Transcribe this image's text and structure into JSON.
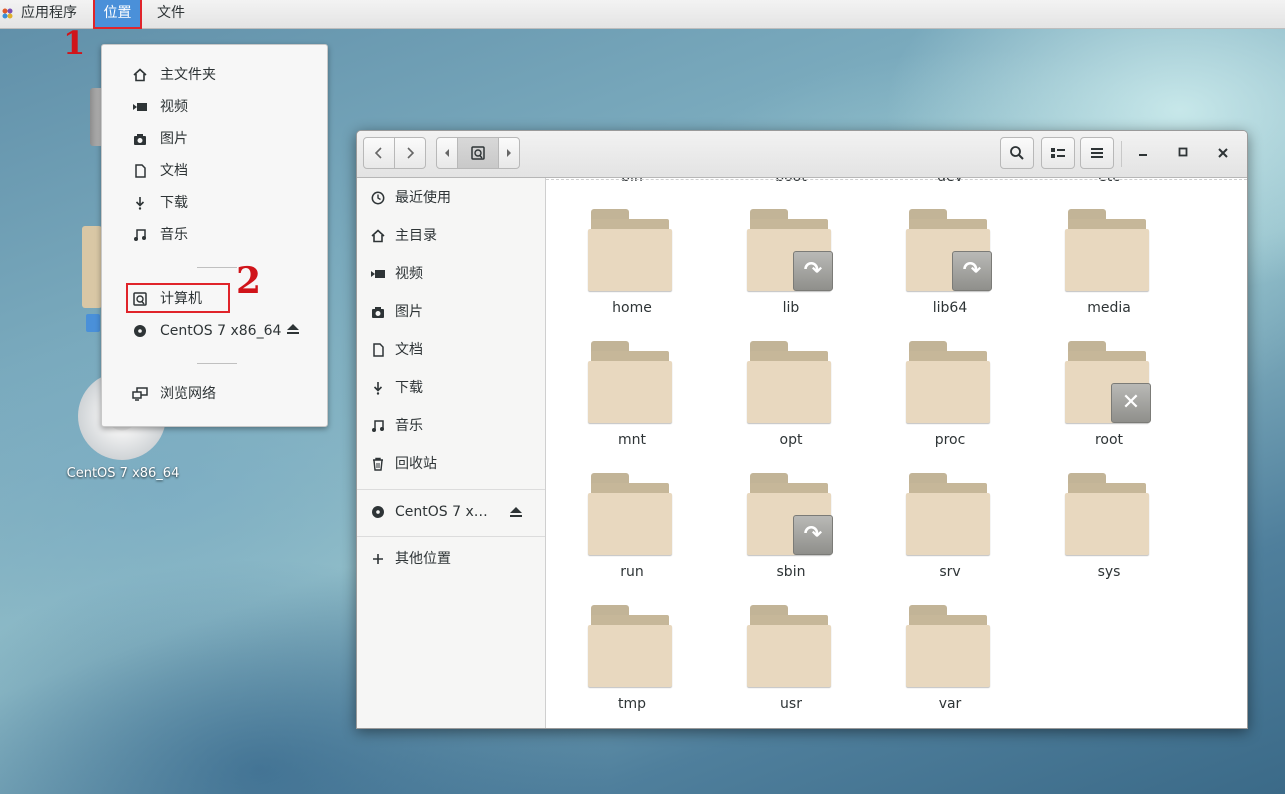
{
  "topbar": {
    "apps": "应用程序",
    "places": "位置",
    "files": "文件"
  },
  "annotations": {
    "step1": "1",
    "step2": "2"
  },
  "desktop": {
    "cd_label": "CentOS 7 x86_64"
  },
  "places_menu": {
    "items": [
      "主文件夹",
      "视频",
      "图片",
      "文档",
      "下载",
      "音乐"
    ],
    "computer": "计算机",
    "cdrom": "CentOS 7 x86_64",
    "network": "浏览网络"
  },
  "file_manager": {
    "sidebar": {
      "recent": "最近使用",
      "home": "主目录",
      "videos": "视频",
      "pictures": "图片",
      "documents": "文档",
      "downloads": "下载",
      "music": "音乐",
      "trash": "回收站",
      "cdrom": "CentOS 7 x…",
      "other": "其他位置"
    },
    "cut_row": [
      "bin",
      "boot",
      "dev",
      "etc"
    ],
    "folders": [
      "home",
      "lib",
      "lib64",
      "media",
      "mnt",
      "opt",
      "proc",
      "root",
      "run",
      "sbin",
      "srv",
      "sys",
      "tmp",
      "usr",
      "var"
    ],
    "emblems": {
      "symlink": "↷",
      "locked": "✕"
    }
  },
  "icons": [
    "apps-icon",
    "home-icon",
    "video-icon",
    "camera-icon",
    "document-icon",
    "download-icon",
    "music-icon",
    "computer-icon",
    "cdrom-icon",
    "eject-icon",
    "network-icon",
    "recent-icon",
    "trash-icon",
    "plus-icon",
    "search-icon",
    "list-view-icon",
    "menu-icon",
    "minimize-icon",
    "maximize-icon",
    "close-icon",
    "folder-icon",
    "symlink-emblem-icon",
    "unreadable-emblem-icon"
  ]
}
